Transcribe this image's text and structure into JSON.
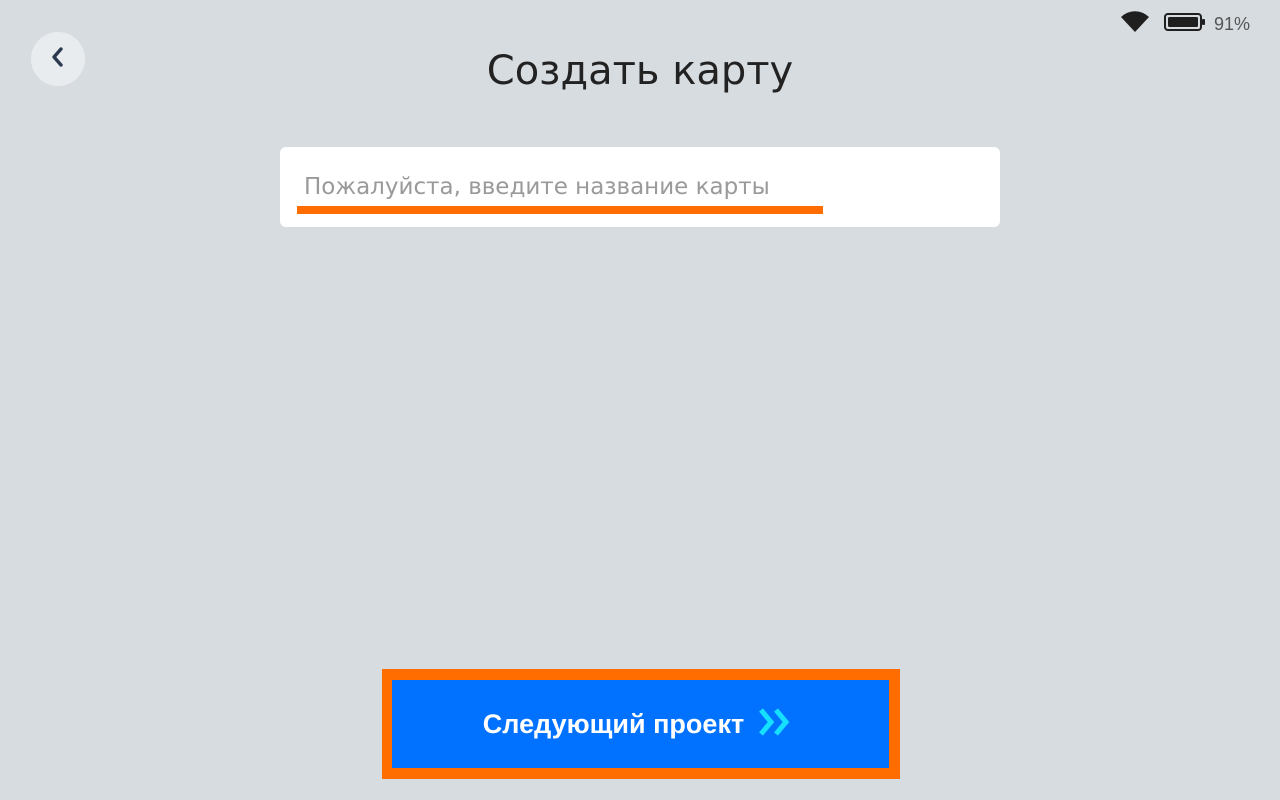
{
  "status_bar": {
    "battery_percent": "91%",
    "battery_level": 0.91,
    "icons": [
      "wifi-icon",
      "battery-icon"
    ]
  },
  "header": {
    "back_icon": "chevron-left-icon",
    "title": "Создать карту"
  },
  "form": {
    "map_name_placeholder": "Пожалуйста, введите название карты",
    "map_name_value": ""
  },
  "footer": {
    "next_label": "Следующий проект",
    "next_icon": "double-chevron-right-icon"
  },
  "colors": {
    "background": "#d7dce0",
    "primary": "#0072ff",
    "highlight": "#ff6d00",
    "arrow_accent": "#16e0ff"
  }
}
